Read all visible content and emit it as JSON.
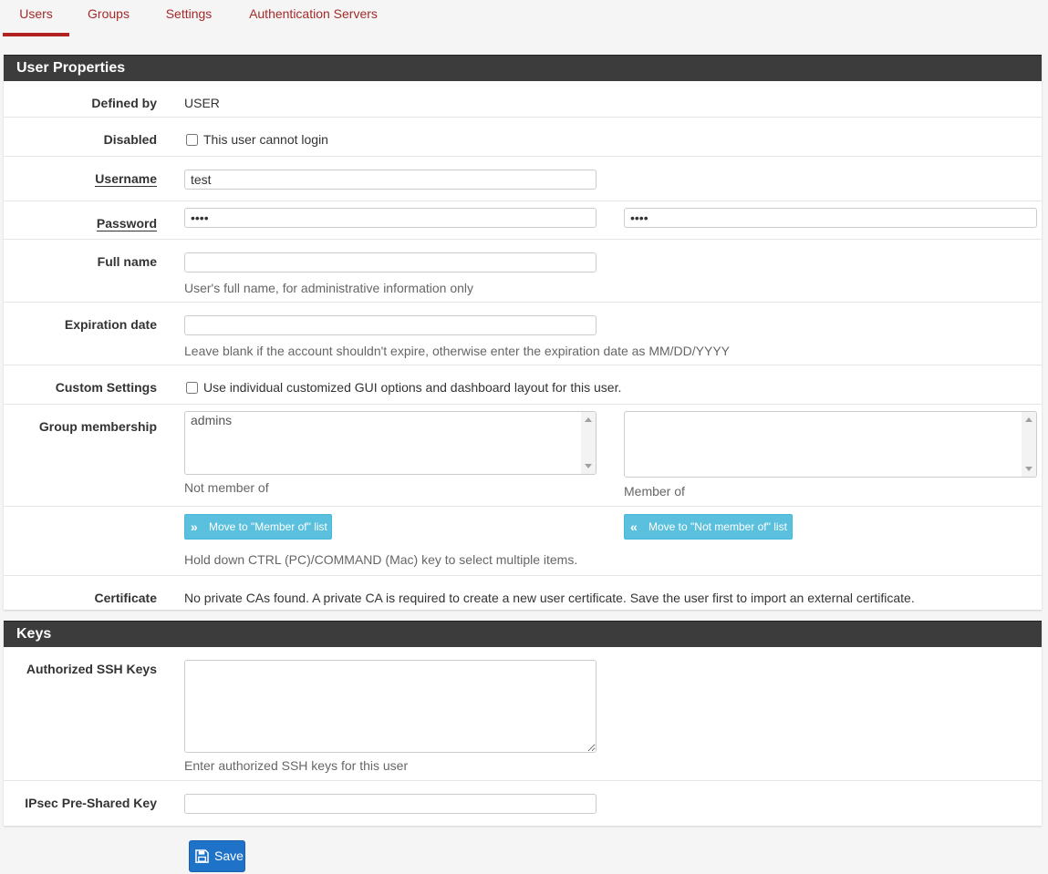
{
  "tabs": [
    {
      "label": "Users",
      "active": true
    },
    {
      "label": "Groups",
      "active": false
    },
    {
      "label": "Settings",
      "active": false
    },
    {
      "label": "Authentication Servers",
      "active": false
    }
  ],
  "user_properties": {
    "heading": "User Properties",
    "defined_by": {
      "label": "Defined by",
      "value": "USER"
    },
    "disabled": {
      "label": "Disabled",
      "checkbox_label": "This user cannot login",
      "checked": false
    },
    "username": {
      "label": "Username",
      "value": "test"
    },
    "password": {
      "label": "Password",
      "value": "test",
      "confirm_value": "test"
    },
    "full_name": {
      "label": "Full name",
      "value": "",
      "help": "User's full name, for administrative information only"
    },
    "expiration_date": {
      "label": "Expiration date",
      "value": "",
      "help": "Leave blank if the account shouldn't expire, otherwise enter the expiration date as MM/DD/YYYY"
    },
    "custom_settings": {
      "label": "Custom Settings",
      "checkbox_label": "Use individual customized GUI options and dashboard layout for this user.",
      "checked": false
    },
    "group_membership": {
      "label": "Group membership",
      "not_member_options": [
        "admins"
      ],
      "member_options": [],
      "not_member_label": "Not member of",
      "member_label": "Member of"
    },
    "move_to_member_label": "Move to \"Member of\" list",
    "move_to_not_member_label": "Move to \"Not member of\" list",
    "multi_select_help": "Hold down CTRL (PC)/COMMAND (Mac) key to select multiple items.",
    "certificate": {
      "label": "Certificate",
      "value": "No private CAs found. A private CA is required to create a new user certificate. Save the user first to import an external certificate."
    }
  },
  "keys": {
    "heading": "Keys",
    "ssh_keys": {
      "label": "Authorized SSH Keys",
      "value": "",
      "help": "Enter authorized SSH keys for this user"
    },
    "ipsec_psk": {
      "label": "IPsec Pre-Shared Key",
      "value": ""
    }
  },
  "save_label": "Save",
  "colors": {
    "accent": "#b22222",
    "panel_heading": "#3c3c3c",
    "info_button": "#5bc0de",
    "primary_button": "#1e72c8"
  }
}
